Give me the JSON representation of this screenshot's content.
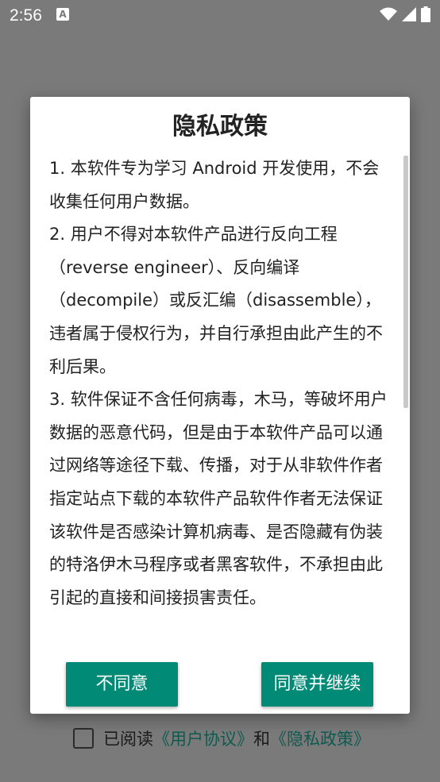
{
  "status_bar": {
    "time": "2:56",
    "notification_icon": "A",
    "icons": [
      "wifi-icon",
      "cellular-signal-icon",
      "battery-icon"
    ]
  },
  "dialog": {
    "title": "隐私政策",
    "paragraphs": [
      "1. 本软件专为学习 Android 开发使用，不会收集任何用户数据。",
      " 2. 用户不得对本软件产品进行反向工程（reverse engineer）、反向编译（decompile）或反汇编（disassemble），违者属于侵权行为，并自行承担由此产生的不利后果。",
      " 3. 软件保证不含任何病毒，木马，等破坏用户数据的恶意代码，但是由于本软件产品可以通过网络等途径下载、传播，对于从非软件作者指定站点下载的本软件产品软件作者无法保证该软件是否感染计算机病毒、是否隐藏有伪装的特洛伊木马程序或者黑客软件，不承担由此引起的直接和间接损害责任。"
    ],
    "buttons": {
      "disagree": "不同意",
      "agree": "同意并继续"
    }
  },
  "agreement": {
    "checked": false,
    "prefix": "已阅读",
    "user_agreement": "《用户协议》",
    "and": "和",
    "privacy_policy": "《隐私政策》"
  },
  "colors": {
    "accent": "#018a76",
    "link": "#0f5a4f",
    "scrim": "#7a7a7a"
  }
}
